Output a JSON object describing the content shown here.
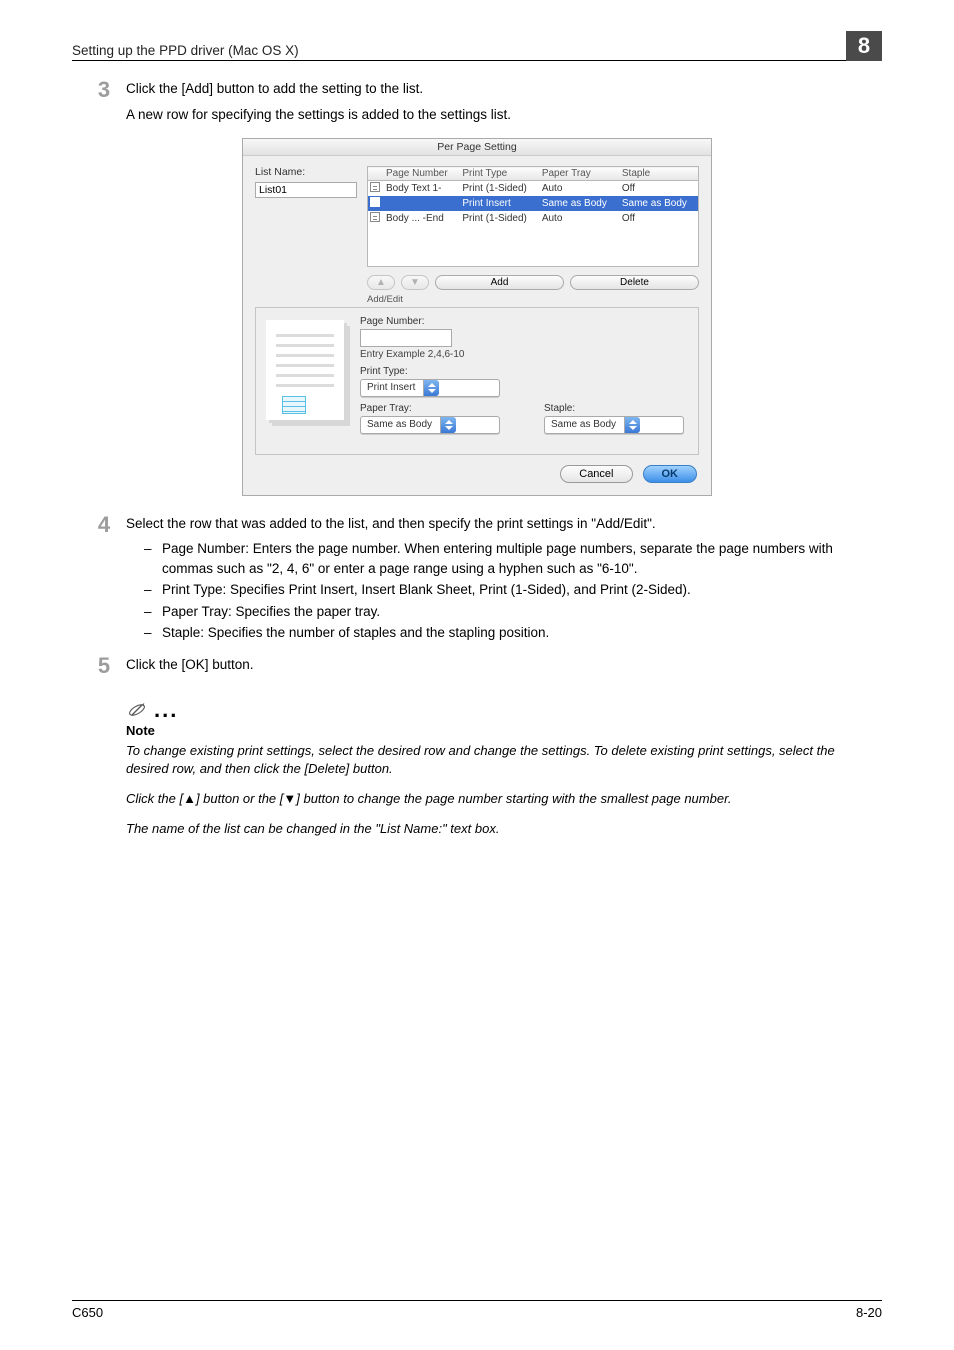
{
  "header": {
    "section_title": "Setting up the PPD driver (Mac OS X)",
    "chapter_num": "8"
  },
  "steps": {
    "s3": {
      "num": "3",
      "p1": "Click the [Add] button to add the setting to the list.",
      "p2": "A new row for specifying the settings is added to the settings list."
    },
    "s4": {
      "num": "4",
      "p1": "Select the row that was added to the list, and then specify the print settings in \"Add/Edit\".",
      "b1": "Page Number: Enters the page number. When entering multiple page numbers, separate the page numbers with commas such as \"2, 4, 6\" or enter a page range using a hyphen such as \"6-10\".",
      "b2": "Print Type: Specifies Print Insert, Insert Blank Sheet, Print (1-Sided), and Print (2-Sided).",
      "b3": "Paper Tray: Specifies the paper tray.",
      "b4": "Staple: Specifies the number of staples and the stapling position."
    },
    "s5": {
      "num": "5",
      "p1": "Click the [OK] button."
    }
  },
  "note": {
    "label": "Note",
    "t1": "To change existing print settings, select the desired row and change the settings. To delete existing print settings, select the desired row, and then click the [Delete] button.",
    "t2": "Click the [▲] button or the [▼] button to change the page number starting with the smallest page number.",
    "t3": "The name of the list can be changed in the \"List Name:\" text box."
  },
  "dialog": {
    "title": "Per Page Setting",
    "list_name_label": "List Name:",
    "list_name_value": "List01",
    "table": {
      "h_page": "Page Number",
      "h_type": "Print Type",
      "h_tray": "Paper Tray",
      "h_staple": "Staple",
      "r1": {
        "page": "Body Text 1-",
        "type": "Print (1-Sided)",
        "tray": "Auto",
        "staple": "Off"
      },
      "r2": {
        "page": "",
        "type": "Print Insert",
        "tray": "Same as Body",
        "staple": "Same as Body"
      },
      "r3": {
        "page": "Body ... -End",
        "type": "Print (1-Sided)",
        "tray": "Auto",
        "staple": "Off"
      }
    },
    "btn_up": "▲",
    "btn_down": "▼",
    "btn_add": "Add",
    "btn_delete": "Delete",
    "addedit_label": "Add/Edit",
    "f_page_label": "Page Number:",
    "f_hint": "Entry Example 2,4,6-10",
    "f_type_label": "Print Type:",
    "f_type_value": "Print Insert",
    "f_tray_label": "Paper Tray:",
    "f_tray_value": "Same as Body",
    "f_staple_label": "Staple:",
    "f_staple_value": "Same as Body",
    "btn_cancel": "Cancel",
    "btn_ok": "OK"
  },
  "footer": {
    "left": "C650",
    "right": "8-20"
  }
}
